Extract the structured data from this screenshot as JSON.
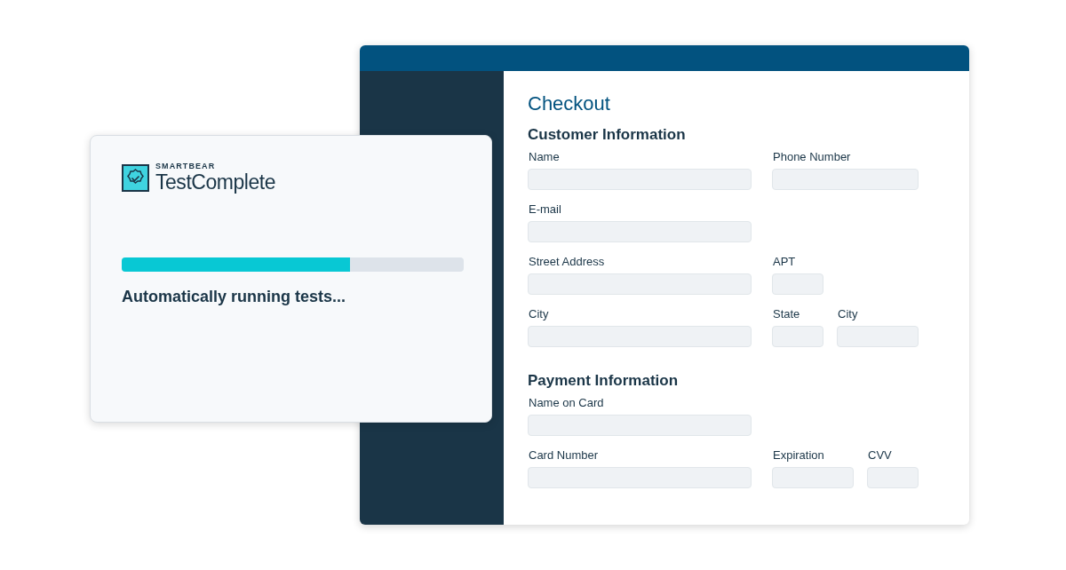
{
  "checkout_window": {
    "title": "Checkout",
    "sections": [
      {
        "heading": "Customer Information",
        "rows": [
          {
            "fields": [
              {
                "label": "Name",
                "kind": "long"
              },
              {
                "label": "Phone Number",
                "kind": "medium"
              }
            ]
          },
          {
            "fields": [
              {
                "label": "E-mail",
                "kind": "long"
              }
            ]
          },
          {
            "fields": [
              {
                "label": "Street Address",
                "kind": "long"
              },
              {
                "label": "APT",
                "kind": "short"
              }
            ]
          },
          {
            "fields": [
              {
                "label": "City",
                "kind": "long"
              },
              {
                "label": "State",
                "kind": "short"
              },
              {
                "label": "City",
                "kind": "compact"
              }
            ]
          }
        ]
      },
      {
        "heading": "Payment Information",
        "rows": [
          {
            "fields": [
              {
                "label": "Name on Card",
                "kind": "long"
              }
            ]
          },
          {
            "fields": [
              {
                "label": "Card Number",
                "kind": "long"
              },
              {
                "label": "Expiration",
                "kind": "compact"
              },
              {
                "label": "CVV",
                "kind": "short"
              }
            ]
          }
        ]
      }
    ]
  },
  "progress_card": {
    "brand": "SMARTBEAR",
    "product": "TestComplete",
    "progress": {
      "level": 0.668
    },
    "status": "Automatically running tests..."
  }
}
